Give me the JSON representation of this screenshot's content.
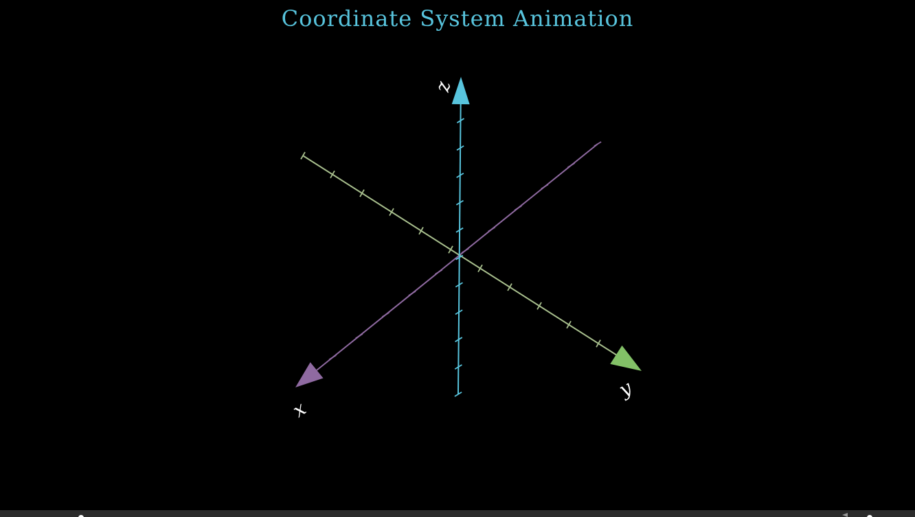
{
  "title": "Coordinate System Animation",
  "axes": {
    "x": {
      "label": "x",
      "color": "#8f6aa1"
    },
    "y": {
      "label": "y",
      "color": "#83c167"
    },
    "z": {
      "label": "z",
      "color": "#58c4dd"
    }
  },
  "colors": {
    "background": "#000000",
    "title": "#58c4dd",
    "label": "#ffffff",
    "y_axis_line": "#a9c08e",
    "player_bar": "#2b2b2b"
  },
  "player": {
    "scrub_icon": "playhead-knob",
    "volume_icon": "speaker-icon"
  }
}
